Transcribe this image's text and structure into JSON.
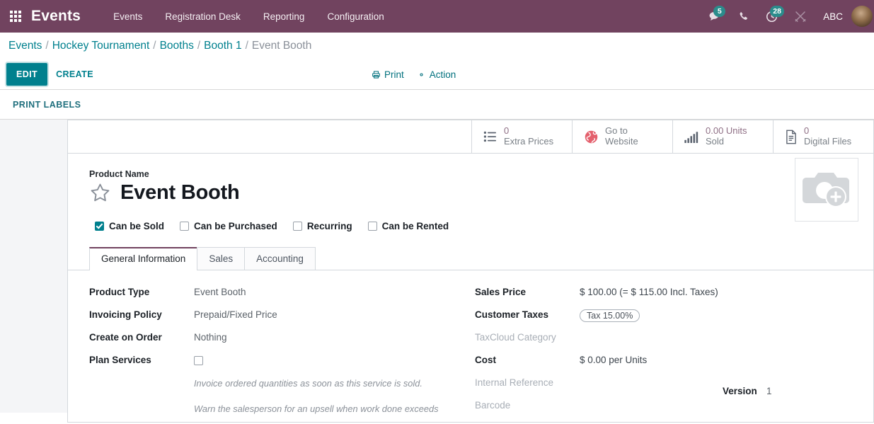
{
  "navbar": {
    "apps_icon": "apps-grid-icon",
    "brand": "Events",
    "menu": [
      {
        "label": "Events"
      },
      {
        "label": "Registration Desk"
      },
      {
        "label": "Reporting"
      },
      {
        "label": "Configuration"
      }
    ],
    "right": {
      "messages_icon": "chat-bubble-icon",
      "messages_count": "5",
      "phone_icon": "phone-icon",
      "activities_icon": "clock-icon",
      "activities_count": "28",
      "debug_icon": "tools-icon",
      "user_name": "ABC",
      "avatar_icon": "user-avatar"
    },
    "accent_color": "#71435F",
    "badge_color": "#2B8C8C"
  },
  "breadcrumb": {
    "items": [
      {
        "label": "Events",
        "current": false
      },
      {
        "label": "Hockey Tournament",
        "current": false
      },
      {
        "label": "Booths",
        "current": false
      },
      {
        "label": "Booth 1",
        "current": false
      },
      {
        "label": "Event Booth",
        "current": true
      }
    ],
    "separator": "/",
    "link_color": "#00808e"
  },
  "control_panel": {
    "edit_label": "EDIT",
    "create_label": "CREATE",
    "print_label": "Print",
    "print_icon": "printer-icon",
    "action_label": "Action",
    "action_icon": "gear-icon",
    "print_labels_label": "PRINT LABELS",
    "primary_color": "#00808e"
  },
  "stat_buttons": [
    {
      "icon": "list-icon",
      "value": "0",
      "label": "Extra Prices"
    },
    {
      "icon": "globe-icon",
      "value": "Go to",
      "label": "Website"
    },
    {
      "icon": "bar-chart-icon",
      "value": "0.00 Units",
      "label": "Sold"
    },
    {
      "icon": "document-icon",
      "value": "0",
      "label": "Digital Files"
    }
  ],
  "product": {
    "name_label": "Product Name",
    "name": "Event Booth",
    "favorite_icon": "star-outline-icon",
    "image_placeholder_icon": "camera-add-icon"
  },
  "checkboxes": [
    {
      "label": "Can be Sold",
      "checked": true
    },
    {
      "label": "Can be Purchased",
      "checked": false
    },
    {
      "label": "Recurring",
      "checked": false
    },
    {
      "label": "Can be Rented",
      "checked": false
    }
  ],
  "tabs": [
    {
      "label": "General Information",
      "active": true
    },
    {
      "label": "Sales",
      "active": false
    },
    {
      "label": "Accounting",
      "active": false
    }
  ],
  "form": {
    "left": [
      {
        "label": "Product Type",
        "value": "Event Booth",
        "muted": false
      },
      {
        "label": "Invoicing Policy",
        "value": "Prepaid/Fixed Price",
        "muted": false
      },
      {
        "label": "Create on Order",
        "value": "Nothing",
        "muted": false
      },
      {
        "label": "Plan Services",
        "value": "",
        "muted": false,
        "checkbox": true
      }
    ],
    "help_texts": [
      "Invoice ordered quantities as soon as this service is sold.",
      "Warn the salesperson for an upsell when work done exceeds"
    ],
    "right": [
      {
        "label": "Sales Price",
        "value": "$ 100.00  (= $ 115.00 Incl. Taxes)",
        "muted": false
      },
      {
        "label": "Customer Taxes",
        "value": "Tax 15.00%",
        "muted": false,
        "tag": true
      },
      {
        "label": "TaxCloud Category",
        "value": "",
        "muted": true
      },
      {
        "label": "Cost",
        "value": "$ 0.00  per Units",
        "muted": false
      },
      {
        "label": "Internal Reference",
        "value": "",
        "muted": true
      },
      {
        "label": "Barcode",
        "value": "",
        "muted": true
      }
    ],
    "version": {
      "label": "Version",
      "value": "1"
    }
  }
}
